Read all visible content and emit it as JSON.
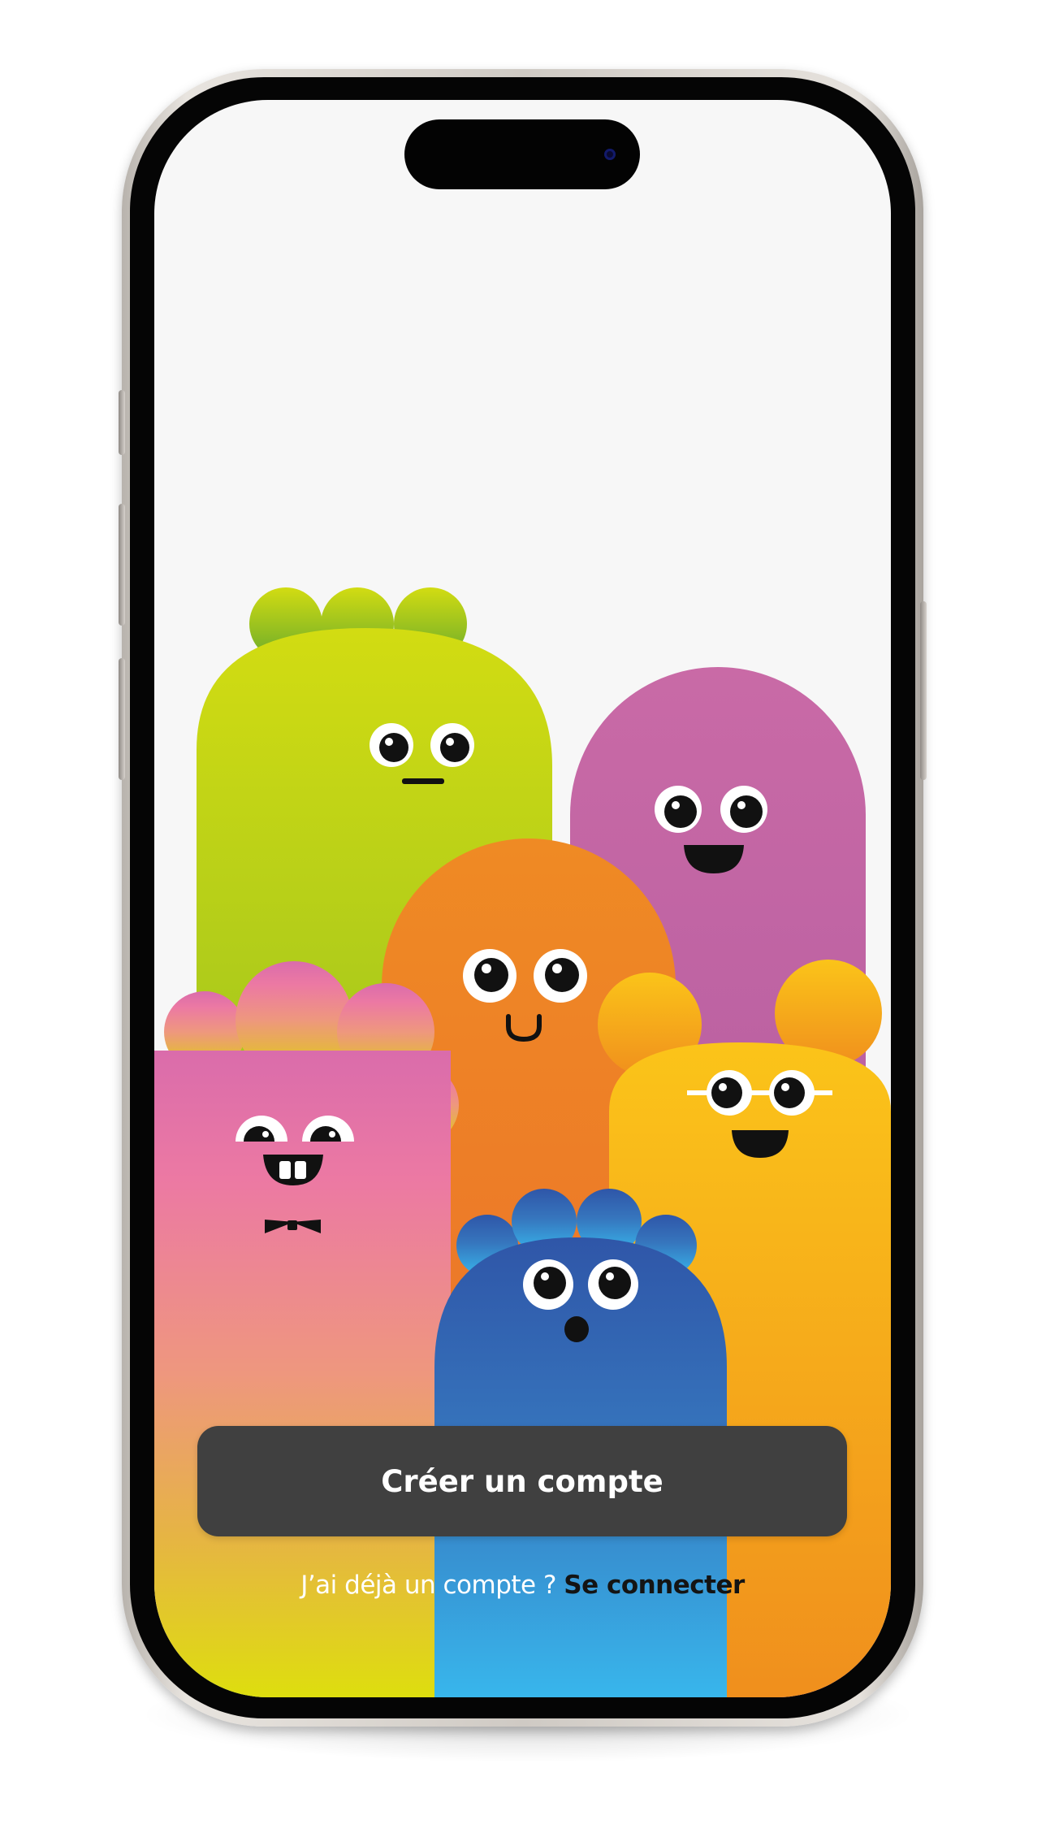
{
  "screen": {
    "background": "#f7f7f7",
    "characters": [
      {
        "name": "green-monster",
        "color": "#a6c826"
      },
      {
        "name": "purple-monster",
        "color": "#b863a6"
      },
      {
        "name": "orange-monster",
        "color": "#ee7f2a"
      },
      {
        "name": "pink-monster",
        "color": "#e377a8"
      },
      {
        "name": "yellow-monster",
        "color": "#f8b51c"
      },
      {
        "name": "blue-monster",
        "color": "#2f62ad"
      }
    ]
  },
  "primary_button": {
    "label": "Créer un compte",
    "background": "#404040"
  },
  "login_prompt": {
    "text": "J’ai déjà un compte ?",
    "link_label": "Se connecter"
  }
}
